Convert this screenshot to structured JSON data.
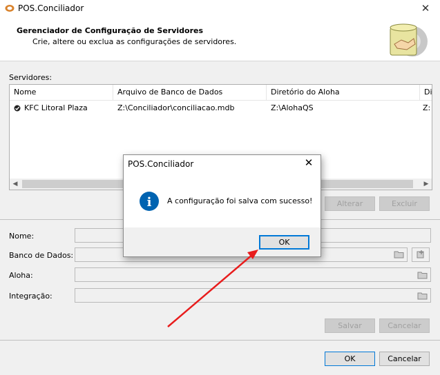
{
  "window": {
    "title": "POS.Conciliador",
    "close_glyph": "✕"
  },
  "header": {
    "title": "Gerenciador de Configuração de Servidores",
    "subtitle": "Crie, altere ou exclua as configurações de servidores."
  },
  "servers": {
    "label": "Servidores:",
    "columns": [
      "Nome",
      "Arquivo de Banco de Dados",
      "Diretório do Aloha",
      "Di"
    ],
    "rows": [
      {
        "nome": "KFC Litoral Plaza",
        "arquivo": "Z:\\Conciliador\\conciliacao.mdb",
        "diretorio": "Z:\\AlohaQS",
        "extra": "Z:"
      }
    ],
    "buttons": {
      "alterar": "Alterar",
      "excluir": "Excluir"
    }
  },
  "form": {
    "nome_label": "Nome:",
    "banco_label": "Banco de Dados:",
    "aloha_label": "Aloha:",
    "integracao_label": "Integração:",
    "salvar": "Salvar",
    "cancelar": "Cancelar"
  },
  "footer": {
    "ok": "OK",
    "cancelar": "Cancelar"
  },
  "dialog": {
    "title": "POS.Conciliador",
    "close_glyph": "✕",
    "message": "A configuração foi salva com sucesso!",
    "ok": "OK",
    "info_glyph": "i"
  },
  "colors": {
    "accent": "#0078d7",
    "info": "#0063b1",
    "annotation_arrow": "#e81c1c"
  }
}
